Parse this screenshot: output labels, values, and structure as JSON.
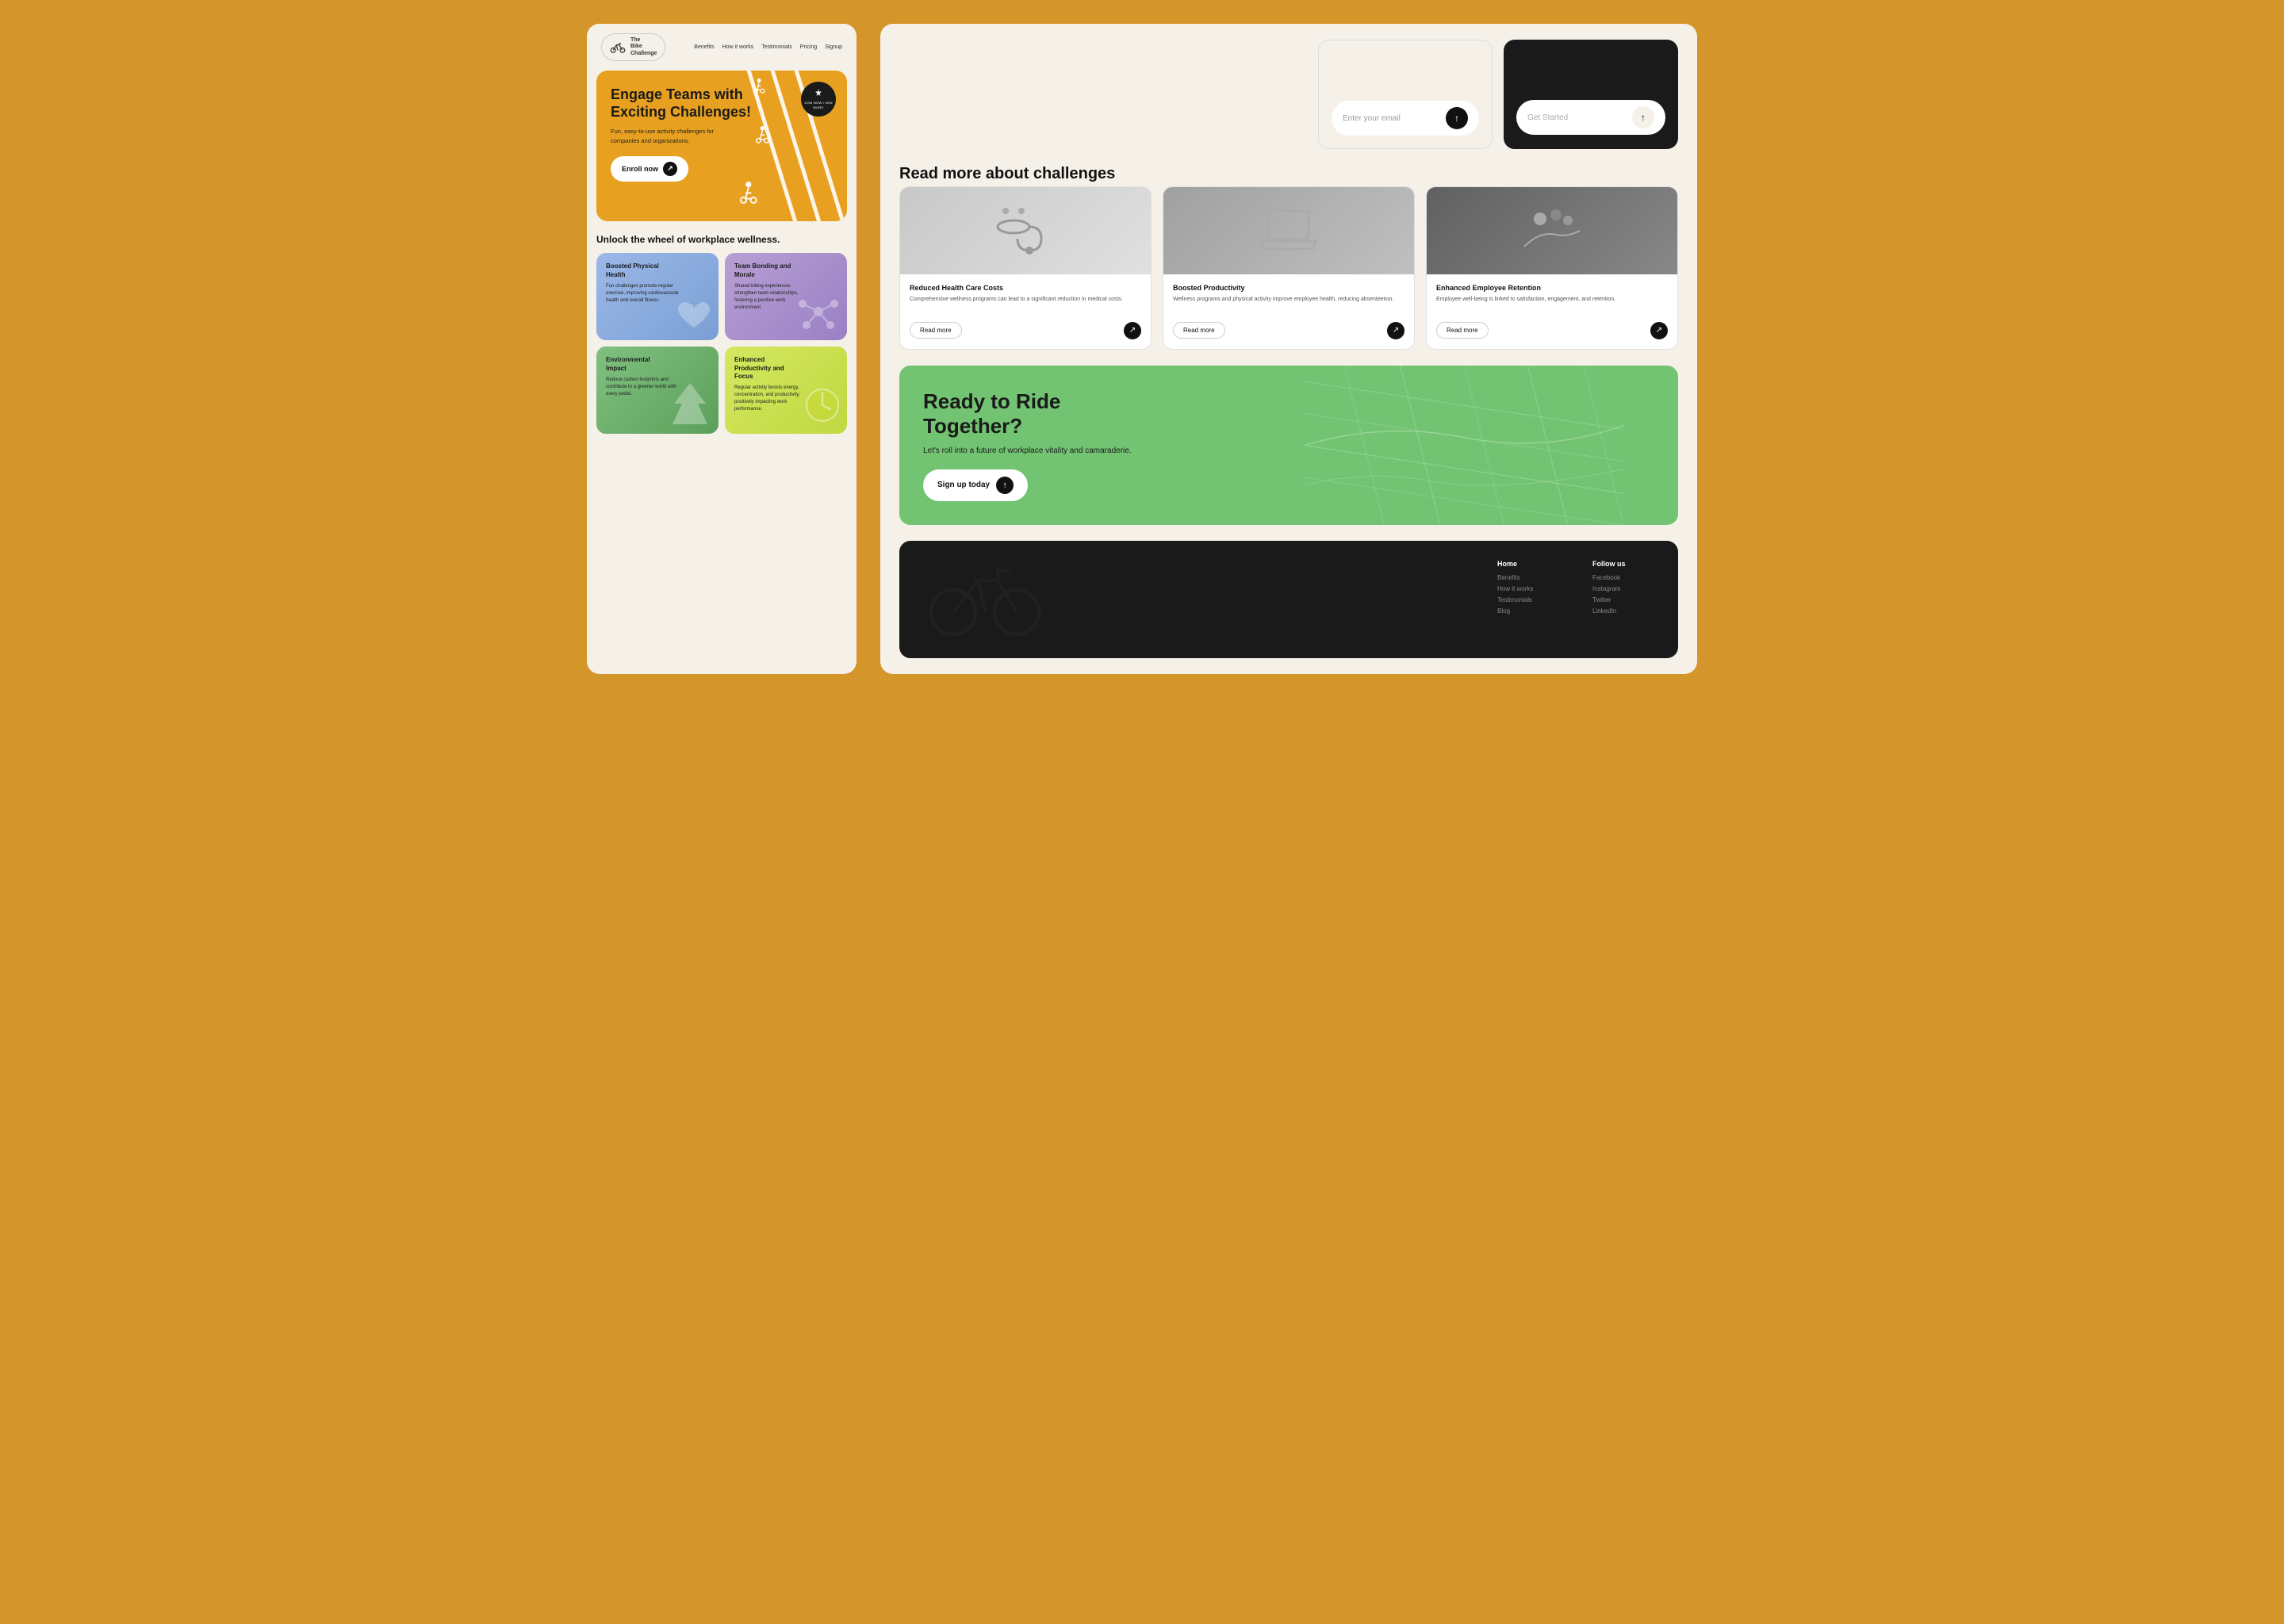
{
  "page": {
    "bg_color": "#D4952A"
  },
  "left": {
    "navbar": {
      "logo_line1": "The",
      "logo_line2": "Bike",
      "logo_line3": "Challenge",
      "links": [
        "Benefits",
        "How it works",
        "Testimonials",
        "Pricing",
        "Signup"
      ]
    },
    "hero": {
      "title": "Engage Teams with Exciting Challenges!",
      "subtitle": "Fun, easy-to-use activity challenges for companies and organizations.",
      "cta_label": "Enroll now",
      "badge_text": "JOIN NOW • WIN MORE"
    },
    "wellness": {
      "section_title": "Unlock the wheel of workplace wellness.",
      "cards": [
        {
          "title": "Boosted Physical Health",
          "desc": "Fun challenges promote regular exercise, improving cardiovascular health and overall fitness.",
          "color": "blue"
        },
        {
          "title": "Team Bonding and Morale",
          "desc": "Shared biking experiences strengthen team relationships, fostering a positive work environment.",
          "color": "purple"
        },
        {
          "title": "Environmental Impact",
          "desc": "Reduce carbon footprints and contribute to a greener world with every pedal.",
          "color": "green"
        },
        {
          "title": "Enhanced Productivity and Focus",
          "desc": "Regular activity boosts energy, concentration, and productivity, positively impacting work performance.",
          "color": "yellow"
        }
      ]
    }
  },
  "right": {
    "top_ctas": [
      {
        "type": "light",
        "placeholder": ""
      },
      {
        "type": "dark",
        "cta_text": "Get Started"
      }
    ],
    "challenges": {
      "section_title": "Read more about challenges",
      "items": [
        {
          "title": "Reduced Health Care Costs",
          "desc": "Comprehensive wellness programs can lead to a significant reduction in medical costs.",
          "read_more": "Read more",
          "img_type": "stethoscope"
        },
        {
          "title": "Boosted Productivity",
          "desc": "Wellness programs and physical activity improve employee health, reducing absenteeism.",
          "read_more": "Read more",
          "img_type": "laptop"
        },
        {
          "title": "Enhanced Employee Retention",
          "desc": "Employee well-being is linked to satisfaction, engagement, and retention.",
          "read_more": "Read more",
          "img_type": "office"
        }
      ]
    },
    "ready": {
      "title": "Ready to Ride Together?",
      "subtitle": "Let's roll into a future of workplace vitality and camaraderie.",
      "cta_label": "Sign up today"
    },
    "footer": {
      "nav_title": "Home",
      "nav_links": [
        "Benefits",
        "How it works",
        "Testimonials",
        "Blog"
      ],
      "social_title": "Follow us",
      "social_links": [
        "Facebook",
        "Instagram",
        "Twitter",
        "LinkedIn"
      ]
    }
  }
}
